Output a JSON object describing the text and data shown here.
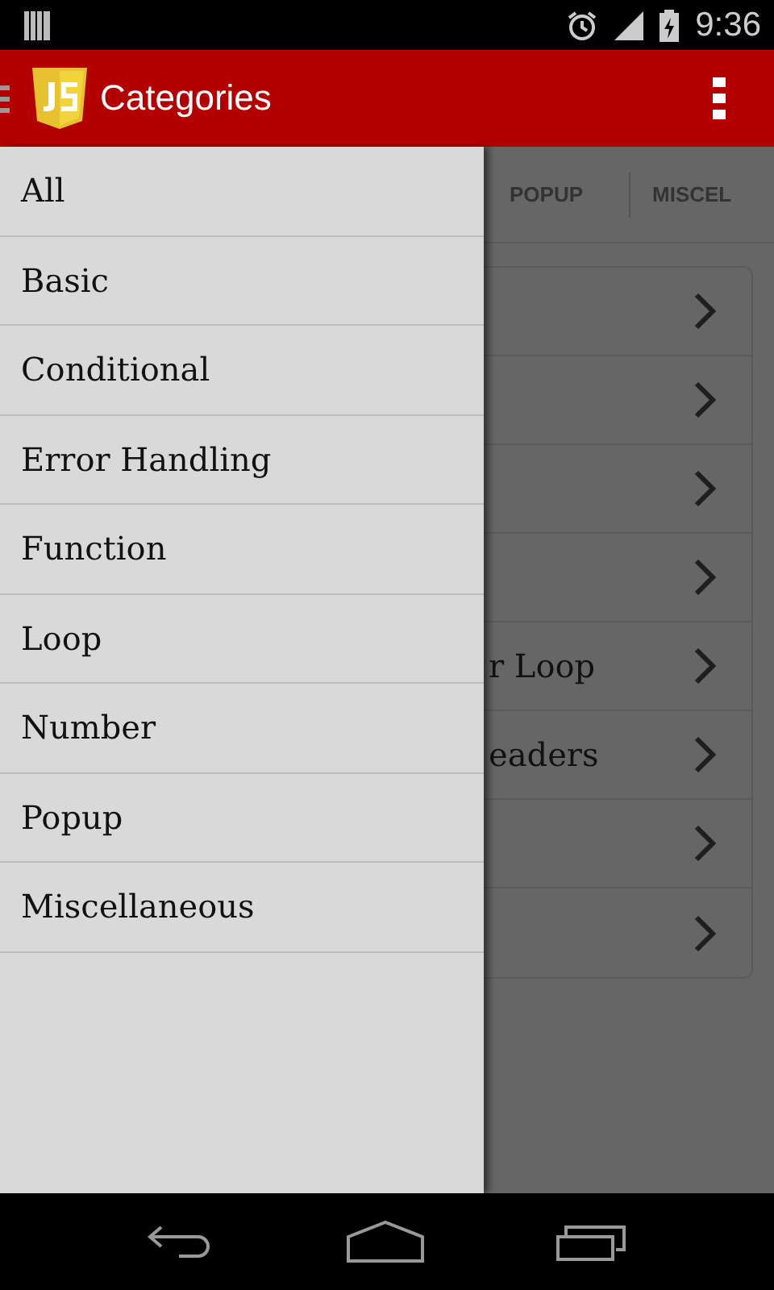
{
  "status_bar": {
    "time": "9:36"
  },
  "app_bar": {
    "title": "Categories"
  },
  "drawer": {
    "items": [
      {
        "label": "All"
      },
      {
        "label": "Basic"
      },
      {
        "label": "Conditional"
      },
      {
        "label": "Error Handling"
      },
      {
        "label": "Function"
      },
      {
        "label": "Loop"
      },
      {
        "label": "Number"
      },
      {
        "label": "Popup"
      },
      {
        "label": "Miscellaneous"
      }
    ]
  },
  "tabs": [
    {
      "label": "POPUP"
    },
    {
      "label": "MISCEL"
    }
  ],
  "list": {
    "rows": [
      {
        "kind": "row"
      },
      {
        "kind": "row"
      },
      {
        "kind": "row"
      },
      {
        "kind": "row"
      },
      {
        "kind": "row",
        "text": "r Loop"
      },
      {
        "kind": "row",
        "text": "eaders"
      },
      {
        "kind": "row"
      },
      {
        "kind": "row"
      }
    ]
  }
}
